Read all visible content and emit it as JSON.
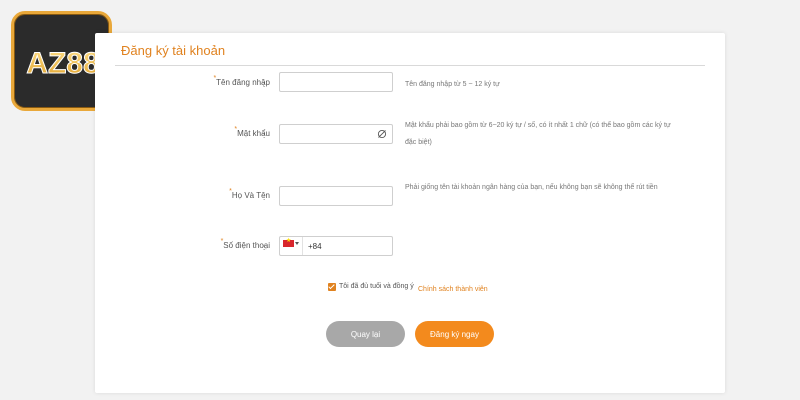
{
  "logo": {
    "text": "AZ88"
  },
  "form": {
    "title": "Đăng ký tài khoản",
    "required_mark": "*",
    "colon": ":",
    "username": {
      "label": "Tên đăng nhập",
      "value": "",
      "hint": "Tên đăng nhập từ 5 ~ 12 ký tự"
    },
    "password": {
      "label": "Mật khẩu",
      "value": "",
      "hint": "Mật khẩu phải bao gồm từ 6~20 ký tự / số, có ít nhất 1 chữ (có thể bao gồm các ký tự đặc biệt)"
    },
    "fullname": {
      "label": "Họ Và Tên",
      "value": "",
      "hint": "Phải giống tên tài khoản ngân hàng của bạn, nếu không bạn sẽ không thể rút tiền"
    },
    "phone": {
      "label": "Số điện thoại",
      "prefix": "+84",
      "value": ""
    },
    "agree": {
      "text": "Tôi đã đủ tuổi và đồng ý",
      "link": "Chính sách thành viên",
      "checked": true
    },
    "buttons": {
      "back": "Quay lại",
      "register": "Đăng ký ngay"
    }
  },
  "colors": {
    "accent": "#e0821f",
    "button_primary": "#f38a1d",
    "button_secondary": "#a8a8a8"
  }
}
